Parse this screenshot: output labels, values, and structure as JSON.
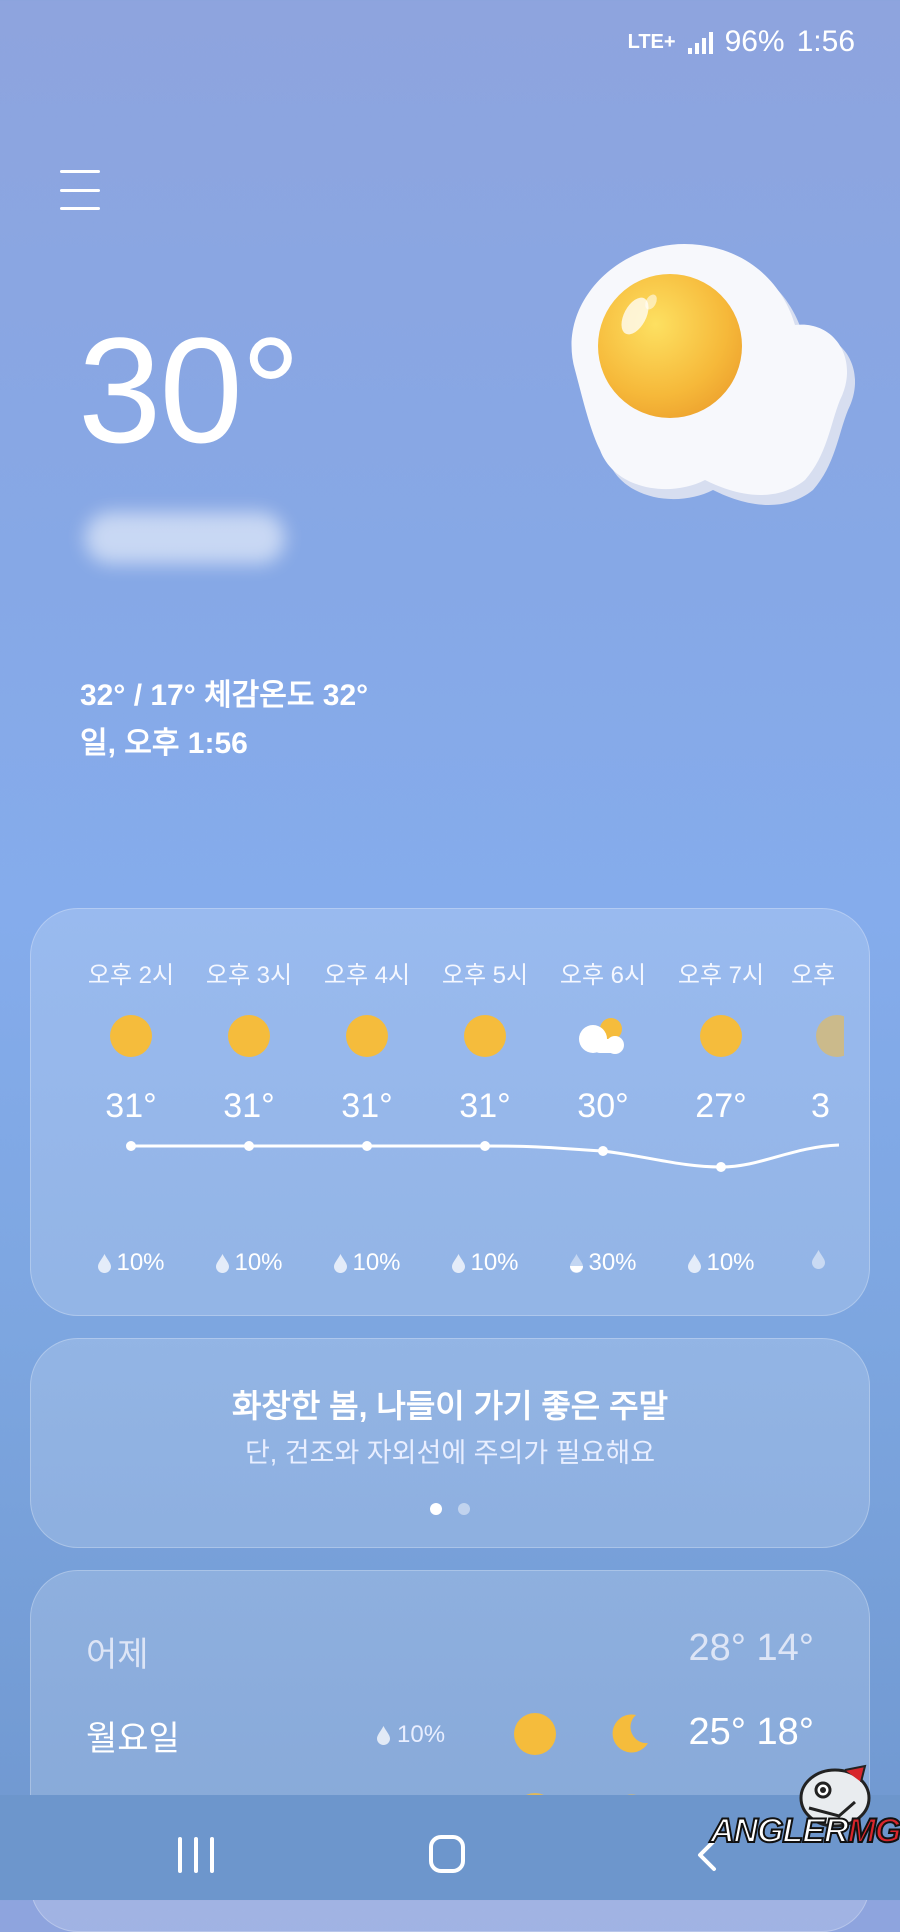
{
  "status_bar": {
    "network": "LTE+",
    "battery": "96%",
    "time": "1:56"
  },
  "current": {
    "temperature": "30°",
    "range_feels": "32° / 17° 체감온도 32°",
    "datetime": "일, 오후 1:56",
    "icon": "fried-egg-sun-icon"
  },
  "hourly": [
    {
      "time": "오후 2시",
      "icon": "sun-icon",
      "temp": "31°",
      "precip": "10%"
    },
    {
      "time": "오후 3시",
      "icon": "sun-icon",
      "temp": "31°",
      "precip": "10%"
    },
    {
      "time": "오후 4시",
      "icon": "sun-icon",
      "temp": "31°",
      "precip": "10%"
    },
    {
      "time": "오후 5시",
      "icon": "sun-icon",
      "temp": "31°",
      "precip": "10%"
    },
    {
      "time": "오후 6시",
      "icon": "partly-cloudy-icon",
      "temp": "30°",
      "precip": "30%"
    },
    {
      "time": "오후 7시",
      "icon": "sun-icon",
      "temp": "27°",
      "precip": "10%"
    },
    {
      "time": "오후",
      "icon": "sun-icon",
      "temp": "3",
      "precip": ""
    }
  ],
  "message": {
    "title": "화창한 봄, 나들이 가기 좋은 주말",
    "subtitle": "단, 건조와 자외선에 주의가 필요해요",
    "active_page": 1,
    "page_count": 2
  },
  "daily": [
    {
      "day": "어제",
      "precip": "",
      "high": "28°",
      "low": "14°",
      "temps": "28° 14°"
    },
    {
      "day": "월요일",
      "precip": "10%",
      "day_icon": "sun-icon",
      "night_icon": "moon-icon",
      "temps": "25° 18°"
    }
  ],
  "watermark": {
    "text_a": "ANGLER",
    "text_b": "MG"
  },
  "colors": {
    "sun": "#f5bc3c",
    "background_top": "#8ea4de",
    "background_bottom": "#6f97cf",
    "watermark_red": "#d8262c"
  }
}
